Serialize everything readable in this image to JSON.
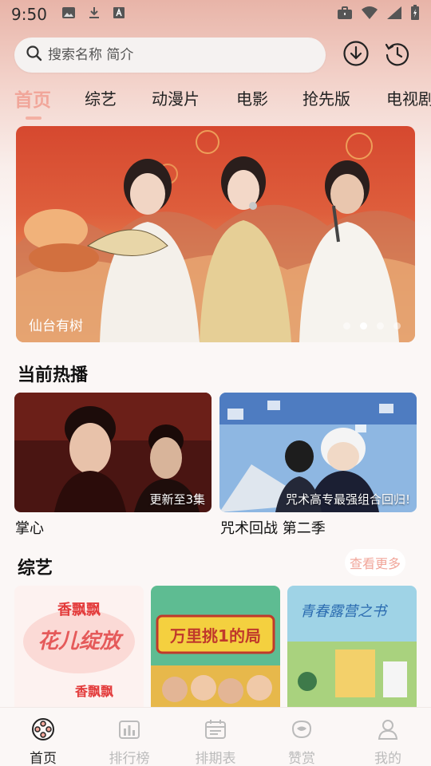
{
  "status_bar": {
    "time": "9:50",
    "left_icons": [
      "image-icon",
      "download-icon",
      "a-box-icon"
    ],
    "right_icons": [
      "briefcase-icon",
      "wifi-icon",
      "signal-icon",
      "battery-icon"
    ]
  },
  "search": {
    "placeholder": "搜索名称 简介",
    "value": ""
  },
  "header_icons": [
    "download-circle-icon",
    "history-icon"
  ],
  "tabs": [
    {
      "label": "首页",
      "active": true
    },
    {
      "label": "综艺",
      "active": false
    },
    {
      "label": "动漫片",
      "active": false
    },
    {
      "label": "电影",
      "active": false
    },
    {
      "label": "抢先版",
      "active": false
    },
    {
      "label": "电视剧",
      "active": false
    }
  ],
  "banner": {
    "caption": "仙台有树",
    "dot_count": 5,
    "active_dot": 1
  },
  "sections": {
    "hot": {
      "title": "当前热播",
      "items": [
        {
          "title": "掌心",
          "badge": "更新至3集"
        },
        {
          "title": "咒术回战 第二季",
          "badge": "咒术高专最强组合回归!"
        }
      ]
    },
    "variety": {
      "title": "综艺",
      "more_label": "查看更多",
      "items": [
        {
          "poster_text": "花儿绽放"
        },
        {
          "poster_text": "万里挑1的局"
        },
        {
          "poster_text": "青春露营之书"
        }
      ]
    }
  },
  "bottom_nav": [
    {
      "label": "首页",
      "icon": "film-reel-icon",
      "active": true
    },
    {
      "label": "排行榜",
      "icon": "bar-chart-icon",
      "active": false
    },
    {
      "label": "排期表",
      "icon": "calendar-icon",
      "active": false
    },
    {
      "label": "赞赏",
      "icon": "gift-icon",
      "active": false
    },
    {
      "label": "我的",
      "icon": "user-icon",
      "active": false
    }
  ],
  "colors": {
    "accent": "#f1a69a",
    "background": "#fbf7f6"
  }
}
